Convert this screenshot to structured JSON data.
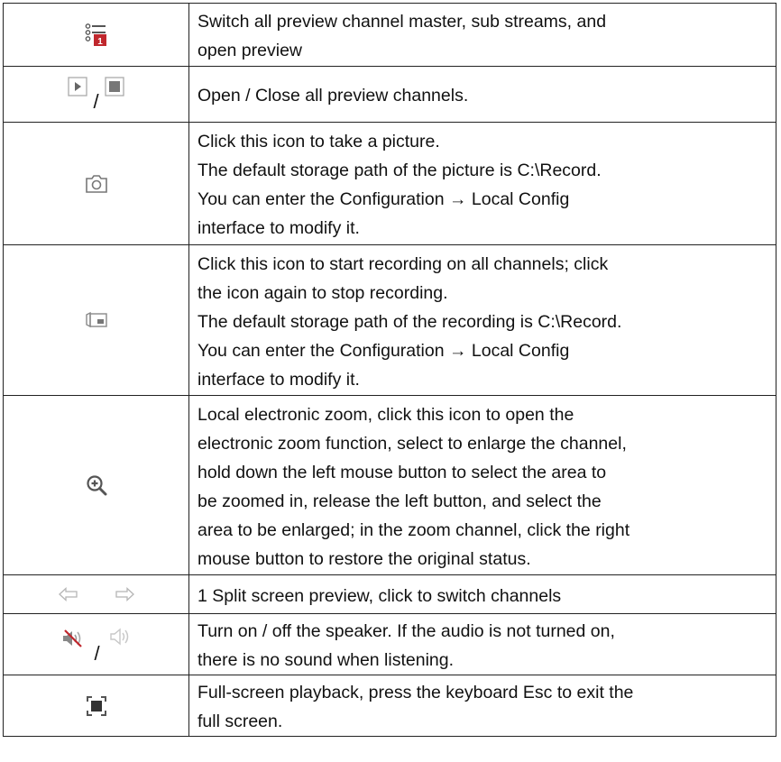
{
  "rows": [
    {
      "icon_names": [
        "stream-switch-icon"
      ],
      "lines": [
        "Switch all preview channel master, sub streams, and",
        "open preview"
      ]
    },
    {
      "icon_names": [
        "play-all-icon",
        "stop-all-icon"
      ],
      "separator": "/",
      "lines": [
        "Open / Close all preview channels."
      ]
    },
    {
      "icon_names": [
        "camera-snapshot-icon"
      ],
      "lines": [
        "Click this icon to take a picture.",
        "The default storage path of the picture is C:\\Record.",
        "You can enter the Configuration → Local Config",
        "interface to modify it."
      ]
    },
    {
      "icon_names": [
        "record-all-icon"
      ],
      "lines": [
        "Click this icon to start recording on all channels; click",
        "the icon again to stop recording.",
        "The default storage path of the recording is C:\\Record.",
        "You can enter the Configuration → Local Config",
        "interface to modify it."
      ]
    },
    {
      "icon_names": [
        "zoom-in-icon"
      ],
      "lines": [
        "Local electronic zoom, click this icon to open the",
        "electronic zoom function, select to enlarge the channel,",
        "hold down the left mouse button to select the area to",
        "be zoomed in, release the left button, and select the",
        "area to be enlarged; in the zoom channel, click the right",
        "mouse button to restore the original status."
      ]
    },
    {
      "icon_names": [
        "arrow-left-icon",
        "arrow-right-icon"
      ],
      "lines": [
        "1 Split screen preview, click to switch channels"
      ]
    },
    {
      "icon_names": [
        "speaker-muted-icon",
        "speaker-on-icon"
      ],
      "separator": "/",
      "lines": [
        "Turn on / off the speaker. If the audio is not turned on,",
        "there is no sound when listening."
      ]
    },
    {
      "icon_names": [
        "fullscreen-icon"
      ],
      "lines": [
        "Full-screen playback, press the keyboard Esc to exit the",
        "full screen."
      ]
    }
  ],
  "colors": {
    "border": "#222222",
    "icon_gray": "#8a8a8a",
    "icon_light": "#c8c8c8",
    "accent_red": "#c0272d"
  }
}
